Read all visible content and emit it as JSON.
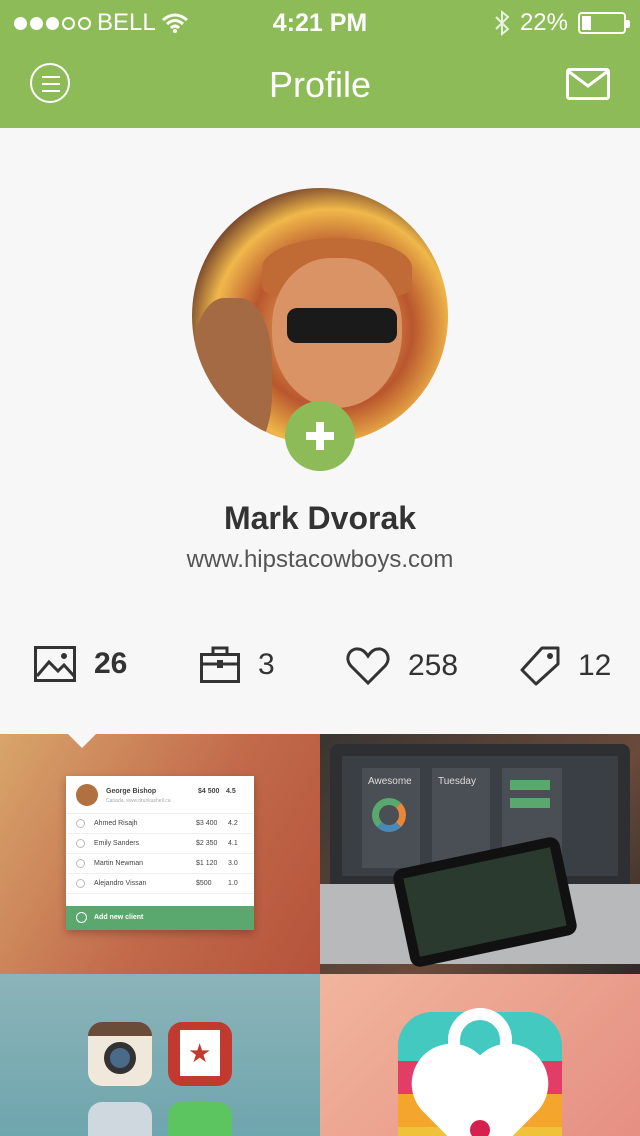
{
  "status_bar": {
    "carrier": "BELL",
    "signal_bars_filled": 3,
    "signal_bars_total": 5,
    "time": "4:21 PM",
    "battery": "22%",
    "battery_level": 0.22
  },
  "nav": {
    "title": "Profile",
    "menu_icon": "hamburger-circle-icon",
    "mail_icon": "mail-icon"
  },
  "profile": {
    "name": "Mark Dvorak",
    "url": "www.hipstacowboys.com",
    "add_icon": "plus-icon"
  },
  "stats": [
    {
      "icon": "image-icon",
      "value": "26"
    },
    {
      "icon": "briefcase-icon",
      "value": "3"
    },
    {
      "icon": "heart-icon",
      "value": "258"
    },
    {
      "icon": "tag-icon",
      "value": "12"
    }
  ],
  "card": {
    "header_name": "George Bishop",
    "header_sub": "Canada, www.drunkashell.ca",
    "header_revenue": "$4 500",
    "header_rating": "4.5",
    "rows": [
      {
        "index": "2",
        "name": "Ahmed Risajh",
        "value": "$3 400",
        "rating": "4.2"
      },
      {
        "index": "3",
        "name": "Emily Sanders",
        "value": "$2 350",
        "rating": "4.1"
      },
      {
        "index": "4",
        "name": "Martin Newman",
        "value": "$1 120",
        "rating": "3.0"
      },
      {
        "index": "5",
        "name": "Alejandro Vissan",
        "value": "$500",
        "rating": "1.0"
      }
    ],
    "footer": "Add new client"
  },
  "laptop_screen": {
    "panel1": "Awesome",
    "panel2": "Tuesday"
  },
  "colors": {
    "accent": "#8cbb57",
    "text_dark": "#333333",
    "background": "#f7f7f7"
  }
}
